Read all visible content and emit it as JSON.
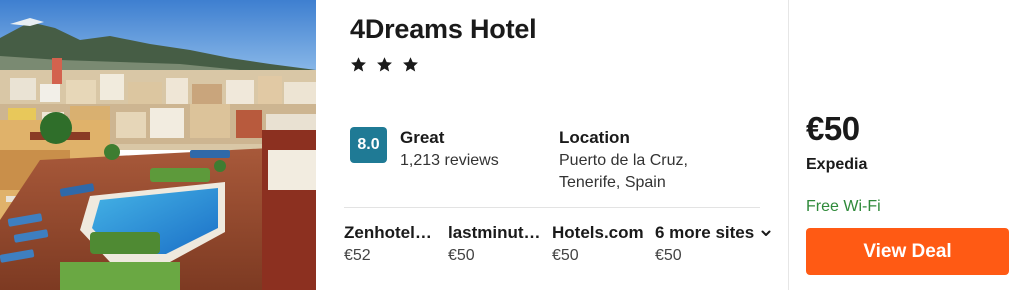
{
  "hotel": {
    "name": "4Dreams Hotel",
    "star_count": 3,
    "star_glyph": "★"
  },
  "rating": {
    "score": "8.0",
    "label": "Great",
    "reviews": "1,213 reviews",
    "badge_color": "#1f7a95"
  },
  "location": {
    "label": "Location",
    "line1": "Puerto de la Cruz,",
    "line2": "Tenerife, Spain"
  },
  "sites": [
    {
      "name": "Zenhotel…",
      "price": "€52"
    },
    {
      "name": "lastminut…",
      "price": "€50"
    },
    {
      "name": "Hotels.com",
      "price": "€50"
    }
  ],
  "more_sites": {
    "label": "6 more sites",
    "price": "€50",
    "icon": "chevron-down-icon"
  },
  "deal": {
    "price": "€50",
    "provider": "Expedia",
    "amenity": "Free Wi-Fi",
    "button_label": "View Deal",
    "button_color": "#ff5a14",
    "amenity_color": "#2f8a3a"
  }
}
